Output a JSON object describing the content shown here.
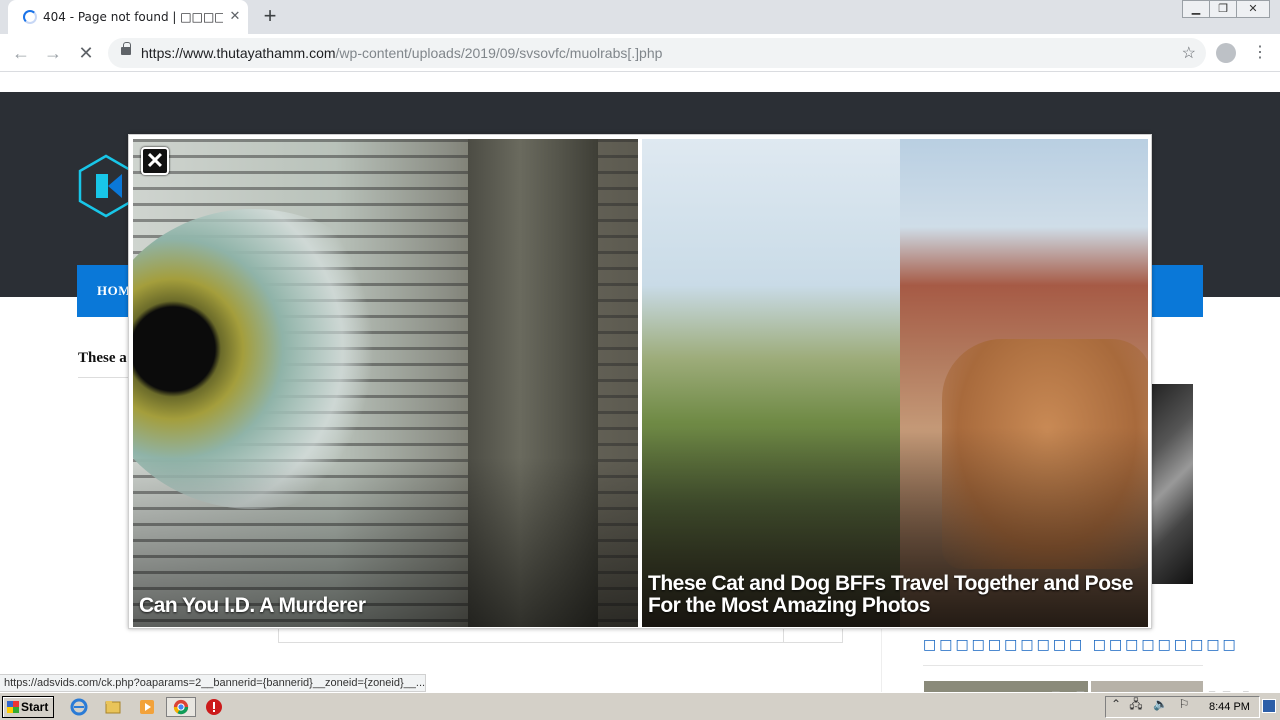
{
  "browser": {
    "tab": {
      "title": "404 - Page not found | □□□□□□□□"
    },
    "url": {
      "host": "https://www.thutayathamm.com",
      "path": "/wp-content/uploads/2019/09/svsovfc/muolrabs[.]php"
    },
    "status_url": "https://adsvids.com/ck.php?oaparams=2__bannerid={bannerid}__zoneid={zoneid}__..."
  },
  "page": {
    "nav_home": "HOM",
    "teaser": "These a",
    "sidebar_heading": "□□□□□□□□□□ □□□□□□□□□"
  },
  "ad": {
    "close_label": "✕",
    "cards": [
      {
        "caption": "Can You I.D. A Murderer"
      },
      {
        "caption": "These Cat and Dog BFFs Travel Together and Pose For the Most Amazing Photos"
      }
    ]
  },
  "taskbar": {
    "start_label": "Start",
    "clock": "8:44 PM"
  },
  "watermark": "ANY RUN",
  "colors": {
    "site_header": "#2b2f35",
    "nav_blue": "#0a78d8",
    "chrome_tabbar": "#dee1e6"
  }
}
